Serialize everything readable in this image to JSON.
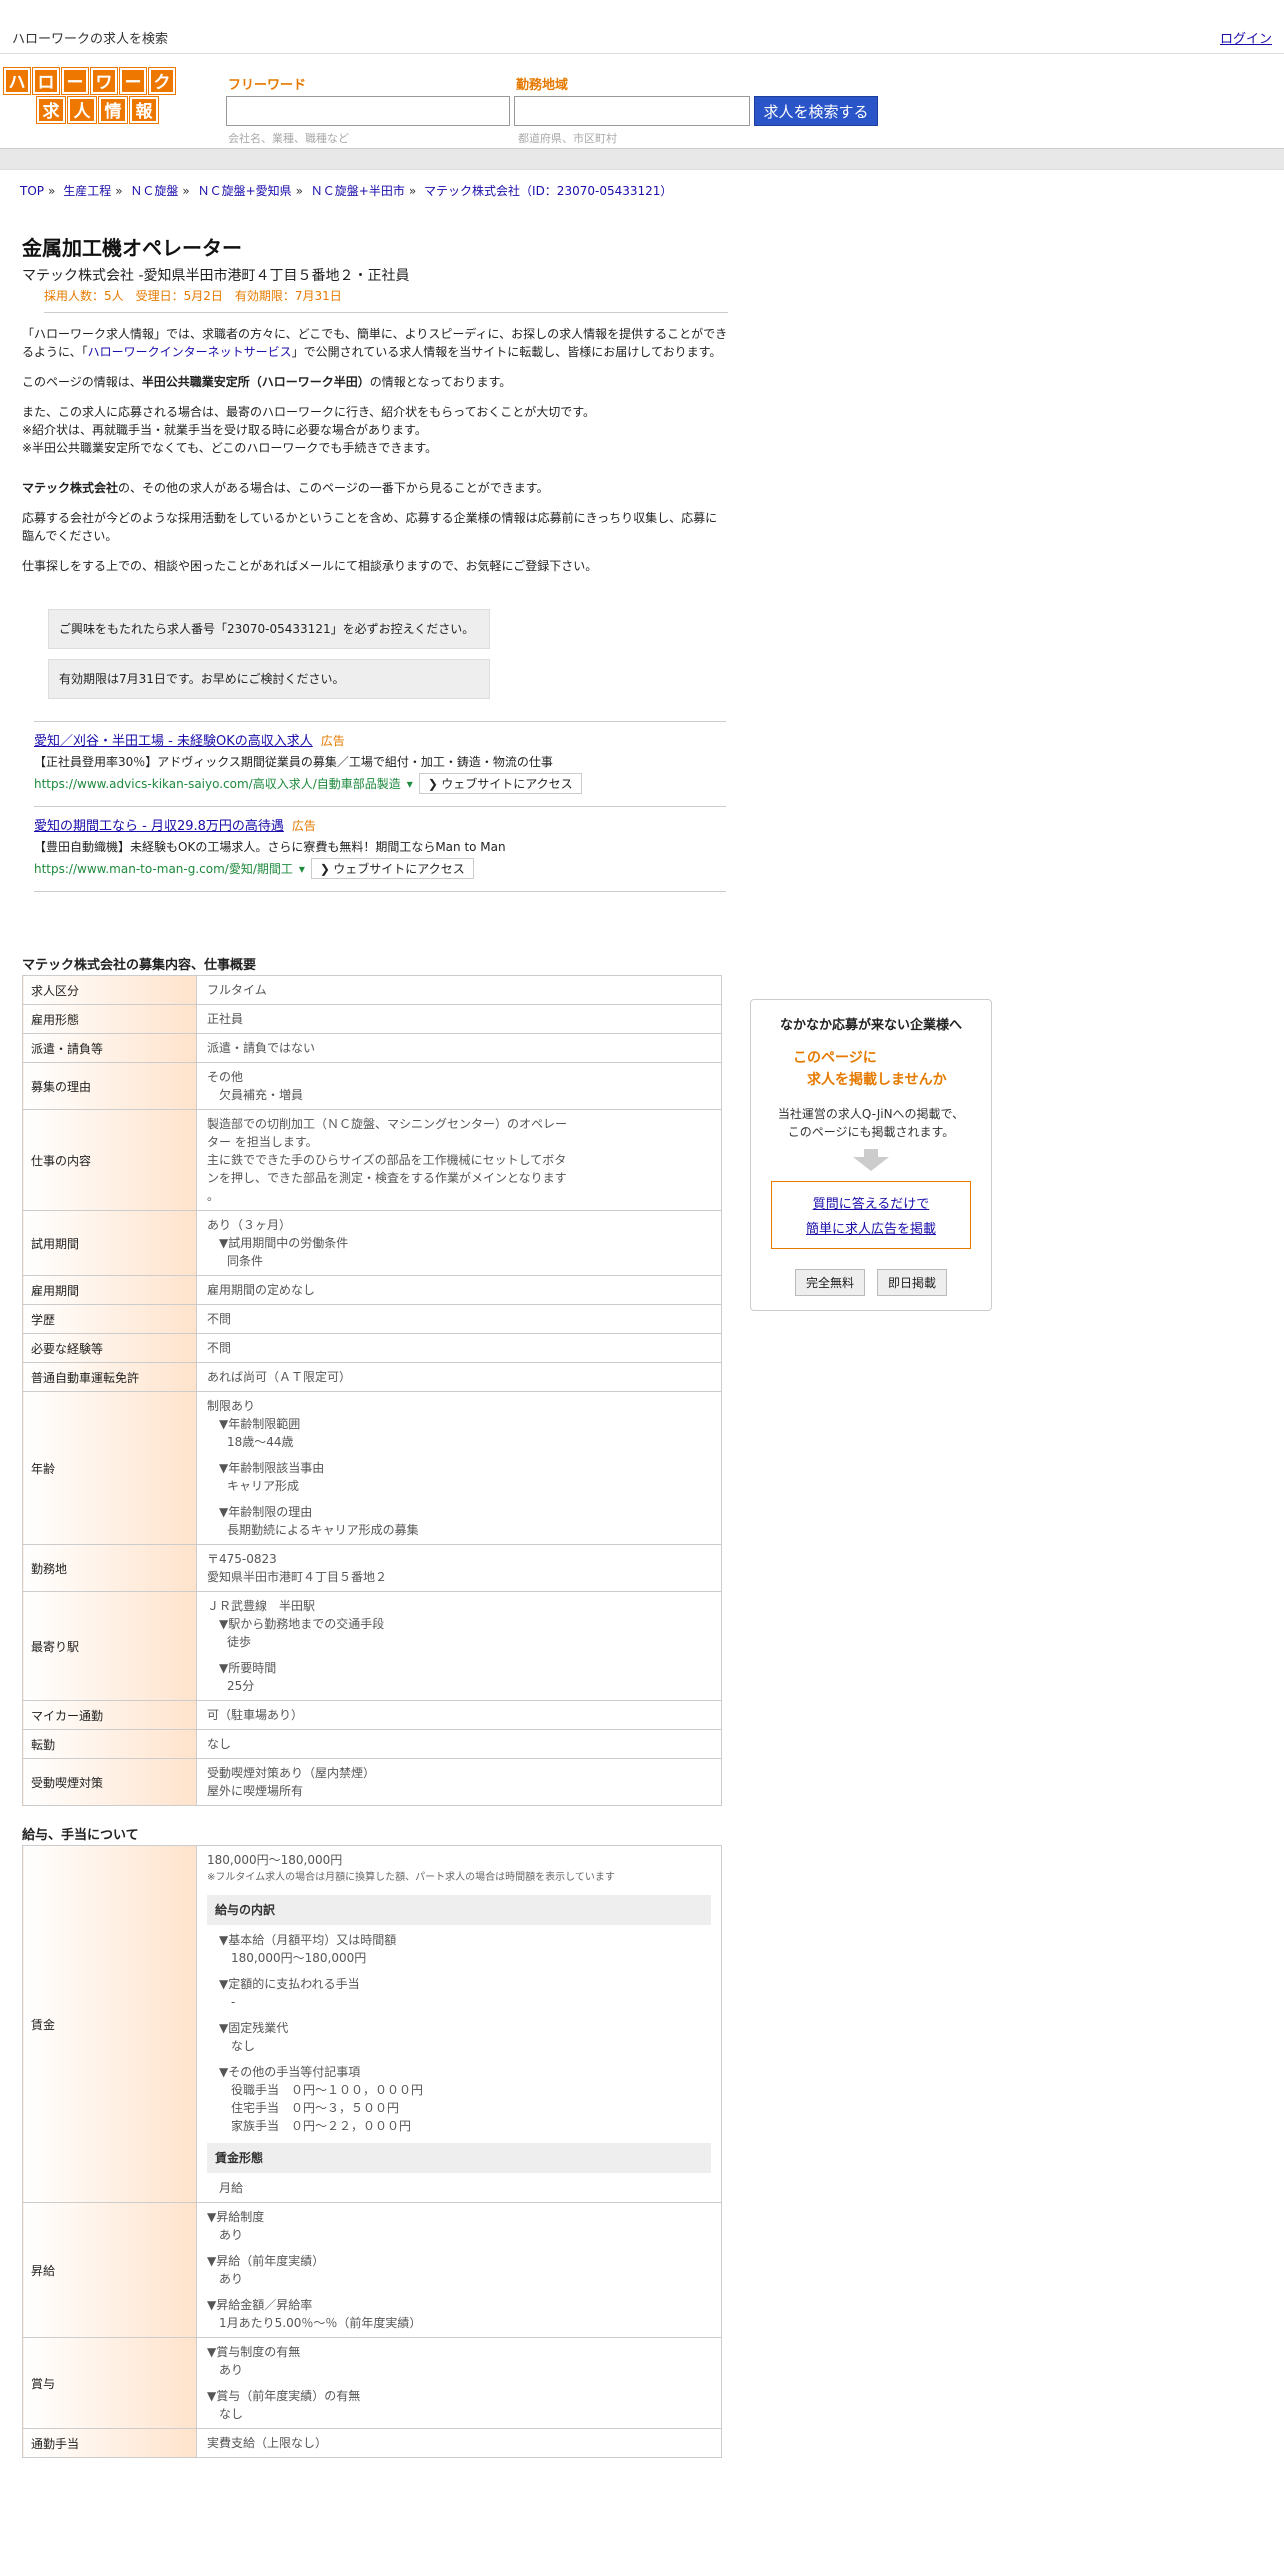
{
  "topbar": {
    "site_title": "ハローワークの求人を検索",
    "login": "ログイン"
  },
  "logo": {
    "row1": [
      "ハ",
      "ロ",
      "ー",
      "ワ",
      "ー",
      "ク"
    ],
    "row2": [
      "求",
      "人",
      "情",
      "報"
    ]
  },
  "search": {
    "keyword_label": "フリーワード",
    "keyword_hint": "会社名、業種、職種など",
    "area_label": "勤務地域",
    "area_hint": "都道府県、市区町村",
    "button": "求人を検索する"
  },
  "breadcrumb": [
    "TOP",
    "生産工程",
    "ＮＣ旋盤",
    "ＮＣ旋盤+愛知県",
    "ＮＣ旋盤+半田市",
    "マテック株式会社（ID：23070-05433121）"
  ],
  "job": {
    "title": "金属加工機オペレーター",
    "subtitle": "マテック株式会社 -愛知県半田市港町４丁目５番地２・正社員",
    "meta": "採用人数：5人　受理日：5月2日　有効期限：7月31日"
  },
  "intro": {
    "p1_pre": "「ハローワーク求人情報」では、求職者の方々に、どこでも、簡単に、よりスピーディに、お探しの求人情報を提供することができるように、「",
    "p1_link": "ハローワークインターネットサービス",
    "p1_post": "」で公開されている求人情報を当サイトに転載し、皆様にお届けしております。",
    "p2_pre": "このページの情報は、",
    "p2_bold": "半田公共職業安定所（ハローワーク半田）",
    "p2_post": "の情報となっております。",
    "p3_l1": "また、この求人に応募される場合は、最寄のハローワークに行き、紹介状をもらっておくことが大切です。",
    "p3_l2": "※紹介状は、再就職手当・就業手当を受け取る時に必要な場合があります。",
    "p3_l3": "※半田公共職業安定所でなくても、どこのハローワークでも手続きできます。",
    "p4_bold": "マテック株式会社",
    "p4_post": "の、その他の求人がある場合は、このページの一番下から見ることができます。",
    "p5": "応募する会社が今どのような採用活動をしているかということを含め、応募する企業様の情報は応募前にきっちり収集し、応募に臨んでください。",
    "p6": "仕事探しをする上での、相談や困ったことがあればメールにて相談承りますので、お気軽にご登録下さい。"
  },
  "notices": [
    "ご興味をもたれたら求人番号「23070-05433121」を必ずお控えください。",
    "有効期限は7月31日です。お早めにご検討ください。"
  ],
  "ads": [
    {
      "title": "愛知／刈谷・半田工場 - 未経験OKの高収入求人",
      "tag": "広告",
      "desc": "【正社員登用率30％】アドヴィックス期間従業員の募集／工場で組付・加工・鋳造・物流の仕事",
      "url": "https://www.advics-kikan-saiyo.com/高収入求人/自動車部品製造",
      "visit": "❯ ウェブサイトにアクセス"
    },
    {
      "title": "愛知の期間工なら - 月収29.8万円の高待遇",
      "tag": "広告",
      "desc": "【豊田自動織機】未経験もOKの工場求人。さらに寮費も無料！期間工ならMan to Man",
      "url": "https://www.man-to-man-g.com/愛知/期間工",
      "visit": "❯ ウェブサイトにアクセス"
    }
  ],
  "recruit": {
    "section_title": "マテック株式会社の募集内容、仕事概要",
    "kyujin_kubun": {
      "label": "求人区分",
      "value": "フルタイム"
    },
    "koyou_keitai": {
      "label": "雇用形態",
      "value": "正社員"
    },
    "haken": {
      "label": "派遣・請負等",
      "value": "派遣・請負ではない"
    },
    "riyu": {
      "label": "募集の理由",
      "v1": "その他",
      "v2": "欠員補充・増員"
    },
    "naiyou": {
      "label": "仕事の内容",
      "l1": "製造部での切削加工（ＮＣ旋盤、マシニングセンター）のオペレー",
      "l2": "ター を担当します。",
      "l3": "主に鉄でできた手のひらサイズの部品を工作機械にセットしてボタ",
      "l4": "ンを押し、できた部品を測定・検査をする作業がメインとなります",
      "l5": "。"
    },
    "shiyou": {
      "label": "試用期間",
      "v1": "あり（３ヶ月）",
      "v2": "▼試用期間中の労働条件",
      "v3": "同条件"
    },
    "kikan": {
      "label": "雇用期間",
      "value": "雇用期間の定めなし"
    },
    "gakureki": {
      "label": "学歴",
      "value": "不問"
    },
    "keiken": {
      "label": "必要な経験等",
      "value": "不問"
    },
    "menkyo": {
      "label": "普通自動車運転免許",
      "value": "あれば尚可（ＡＴ限定可）"
    },
    "nenrei": {
      "label": "年齢",
      "v1": "制限あり",
      "h1": "▼年齢制限範囲",
      "d1": "18歳〜44歳",
      "h2": "▼年齢制限該当事由",
      "d2": "キャリア形成",
      "h3": "▼年齢制限の理由",
      "d3": "長期勤続によるキャリア形成の募集"
    },
    "kinmuchi": {
      "label": "勤務地",
      "v1": "〒475-0823",
      "v2": "愛知県半田市港町４丁目５番地２"
    },
    "eki": {
      "label": "最寄り駅",
      "v1": "ＪＲ武豊線　半田駅",
      "h1": "▼駅から勤務地までの交通手段",
      "d1": "徒歩",
      "h2": "▼所要時間",
      "d2": "25分"
    },
    "mycar": {
      "label": "マイカー通勤",
      "value": "可（駐車場あり）"
    },
    "tenkin": {
      "label": "転勤",
      "value": "なし"
    },
    "judou": {
      "label": "受動喫煙対策",
      "v1": "受動喫煙対策あり（屋内禁煙）",
      "v2": "屋外に喫煙場所有"
    }
  },
  "salary": {
    "section_title": "給与、手当について",
    "chingin": {
      "label": "賃金",
      "range": "180,000円〜180,000円",
      "note": "※フルタイム求人の場合は月額に換算した額、パート求人の場合は時間額を表示しています",
      "breakdown_head": "給与の内訳",
      "h1": "▼基本給（月額平均）又は時間額",
      "d1": "180,000円〜180,000円",
      "h2": "▼定額的に支払われる手当",
      "d2": "-",
      "h3": "▼固定残業代",
      "d3": "なし",
      "h4": "▼その他の手当等付記事項",
      "d4a": "役職手当　０円～１００，０００円",
      "d4b": "住宅手当　０円～３，５００円",
      "d4c": "家族手当　０円～２２，０００円",
      "form_head": "賃金形態",
      "form_value": "月給"
    },
    "shokyu": {
      "label": "昇給",
      "h1": "▼昇給制度",
      "d1": "あり",
      "h2": "▼昇給（前年度実績）",
      "d2": "あり",
      "h3": "▼昇給金額／昇給率",
      "d3": "1月あたり5.00％〜％（前年度実績）"
    },
    "shoyo": {
      "label": "賞与",
      "h1": "▼賞与制度の有無",
      "d1": "あり",
      "h2": "▼賞与（前年度実績）の有無",
      "d2": "なし"
    },
    "tsukin": {
      "label": "通勤手当",
      "value": "実費支給（上限なし）"
    }
  },
  "side": {
    "title": "なかなか応募が来ない企業様へ",
    "accent1": "このページに",
    "accent2": "求人を掲載しませんか",
    "body1": "当社運営の求人Q-JiNへの掲載で、",
    "body2": "このページにも掲載されます。",
    "link1": "質問に答えるだけで",
    "link2": "簡単に求人広告を掲載",
    "btn1": "完全無料",
    "btn2": "即日掲載"
  }
}
